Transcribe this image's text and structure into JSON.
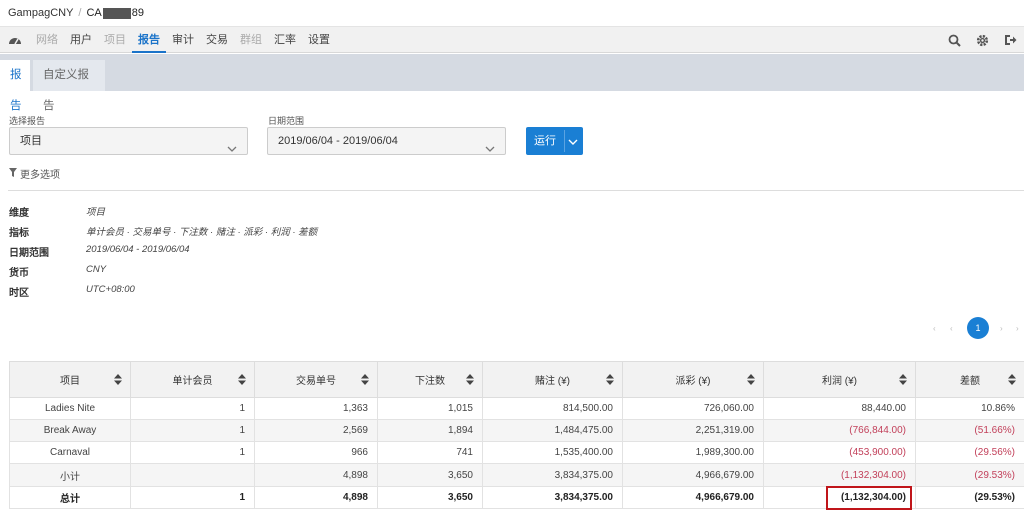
{
  "breadcrumb": {
    "root": "GampagCNY",
    "separator": "/",
    "account_prefix": "CA",
    "account_suffix": "89"
  },
  "nav": {
    "items": [
      {
        "label": "网络",
        "dim": true
      },
      {
        "label": "用户",
        "dim": false
      },
      {
        "label": "项目",
        "dim": true
      },
      {
        "label": "报告",
        "dim": false,
        "active": true
      },
      {
        "label": "审计",
        "dim": false
      },
      {
        "label": "交易",
        "dim": false
      },
      {
        "label": "群组",
        "dim": true
      },
      {
        "label": "汇率",
        "dim": false
      },
      {
        "label": "设置",
        "dim": false
      }
    ],
    "icons": [
      "dashboard-icon",
      "search-icon",
      "gear-icon",
      "logout-icon"
    ]
  },
  "tabs": {
    "report": "报告",
    "custom": "自定义报告"
  },
  "form": {
    "report_label": "选择报告",
    "report_value": "项目",
    "date_label": "日期范围",
    "date_value": "2019/06/04 - 2019/06/04",
    "run_label": "运行",
    "more_options": "更多选项"
  },
  "summary": {
    "dimension_key": "维度",
    "dimension_val": "项目",
    "metrics_key": "指标",
    "metrics_val": "单计会员 · 交易单号 · 下注数 · 赌注 · 派彩 · 利润 · 差额",
    "date_key": "日期范围",
    "date_val": "2019/06/04 - 2019/06/04",
    "currency_key": "货币",
    "currency_val": "CNY",
    "tz_key": "时区",
    "tz_val": "UTC+08:00"
  },
  "pagination": {
    "current": "1"
  },
  "table": {
    "headers": [
      "项目",
      "单计会员",
      "交易单号",
      "下注数",
      "赌注 (¥)",
      "派彩 (¥)",
      "利润 (¥)",
      "差额"
    ],
    "rows": [
      [
        "Ladies Nite",
        "1",
        "1,363",
        "1,015",
        "814,500.00",
        "726,060.00",
        "88,440.00",
        "10.86%"
      ],
      [
        "Break Away",
        "1",
        "2,569",
        "1,894",
        "1,484,475.00",
        "2,251,319.00",
        "(766,844.00)",
        "(51.66%)"
      ],
      [
        "Carnaval",
        "1",
        "966",
        "741",
        "1,535,400.00",
        "1,989,300.00",
        "(453,900.00)",
        "(29.56%)"
      ]
    ],
    "subtotal": [
      "小计",
      "",
      "4,898",
      "3,650",
      "3,834,375.00",
      "4,966,679.00",
      "(1,132,304.00)",
      "(29.53%)"
    ],
    "total": [
      "总计",
      "1",
      "4,898",
      "3,650",
      "3,834,375.00",
      "4,966,679.00",
      "(1,132,304.00)",
      "(29.53%)"
    ]
  },
  "colors": {
    "accent": "#1a7fd4",
    "negative": "#c2405a",
    "highlight": "#c0151a"
  }
}
